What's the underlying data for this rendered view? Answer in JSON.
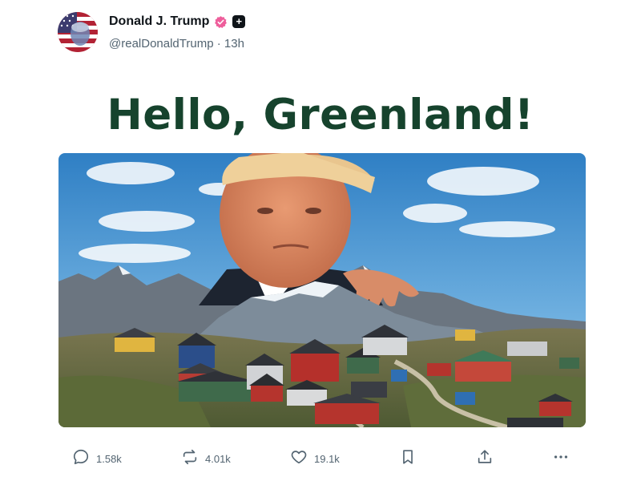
{
  "author": {
    "display_name": "Donald J. Trump",
    "handle": "@realDonaldTrump",
    "separator": "·",
    "time": "13h",
    "verified_icon": "verified-badge-icon",
    "plus_icon": "plus-badge-icon"
  },
  "post": {
    "headline": "Hello, Greenland!"
  },
  "actions": {
    "reply_count": "1.58k",
    "repost_count": "4.01k",
    "like_count": "19.1k"
  },
  "colors": {
    "headline": "#16432d",
    "muted": "#536471",
    "verified": "#ee5e9b",
    "sky_top": "#2f7fc4",
    "sky_bottom": "#9fcbe8"
  }
}
